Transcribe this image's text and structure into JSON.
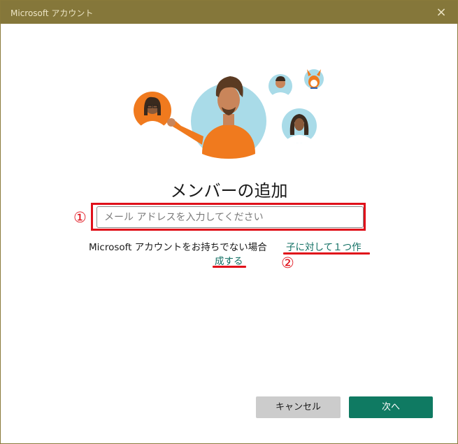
{
  "window": {
    "title": "Microsoft アカウント",
    "close_icon": "×"
  },
  "main": {
    "heading": "メンバーの追加",
    "email_input": {
      "placeholder": "メール アドレスを入力してください",
      "value": ""
    },
    "no_account_text": "Microsoft アカウントをお持ちでない場合",
    "create_child_link_part1": "子に対して１つ作",
    "create_child_link_part2": "成する"
  },
  "annotations": {
    "marker1": "①",
    "marker2": "②"
  },
  "buttons": {
    "cancel": "キャンセル",
    "next": "次へ"
  },
  "colors": {
    "titlebar": "#85773a",
    "accent": "#0f7a62",
    "link": "#0f6e62",
    "annotation_red": "#e0101a",
    "cancel_button": "#cccccc"
  },
  "icons": {
    "illustration": "family-members-illustration"
  }
}
